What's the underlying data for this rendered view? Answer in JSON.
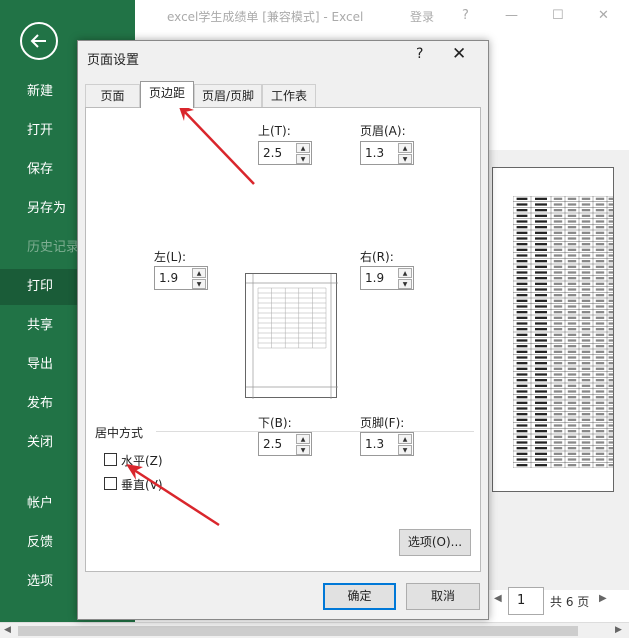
{
  "window": {
    "title": "excel学生成绩单  [兼容模式]  -  Excel",
    "login": "登录",
    "help": "?",
    "minimize": "—",
    "maximize": "☐",
    "close": "✕"
  },
  "sidebar": {
    "items": [
      {
        "label": "新建"
      },
      {
        "label": "打开"
      },
      {
        "label": "保存"
      },
      {
        "label": "另存为"
      },
      {
        "label": "历史记录"
      },
      {
        "label": "打印"
      },
      {
        "label": "共享"
      },
      {
        "label": "导出"
      },
      {
        "label": "发布"
      },
      {
        "label": "关闭"
      },
      {
        "label": "帐户"
      },
      {
        "label": "反馈"
      },
      {
        "label": "选项"
      }
    ]
  },
  "dialog": {
    "title": "页面设置",
    "help": "?",
    "close": "✕",
    "tabs": [
      "页面",
      "页边距",
      "页眉/页脚",
      "工作表"
    ],
    "margins": {
      "top_label": "上(T):",
      "top_value": "2.5",
      "header_label": "页眉(A):",
      "header_value": "1.3",
      "left_label": "左(L):",
      "left_value": "1.9",
      "right_label": "右(R):",
      "right_value": "1.9",
      "bottom_label": "下(B):",
      "bottom_value": "2.5",
      "footer_label": "页脚(F):",
      "footer_value": "1.3"
    },
    "center": {
      "group_label": "居中方式",
      "horizontal": "水平(Z)",
      "vertical": "垂直(V)",
      "horizontal_checked": false,
      "vertical_checked": false
    },
    "options_button": "选项(O)...",
    "ok_button": "确定",
    "cancel_button": "取消"
  },
  "pager": {
    "current": "1",
    "total": "共 6 页"
  },
  "colors": {
    "sidebar": "#217346",
    "sidebar_active": "#1a5c38",
    "annotation_arrow": "#d9262c"
  }
}
